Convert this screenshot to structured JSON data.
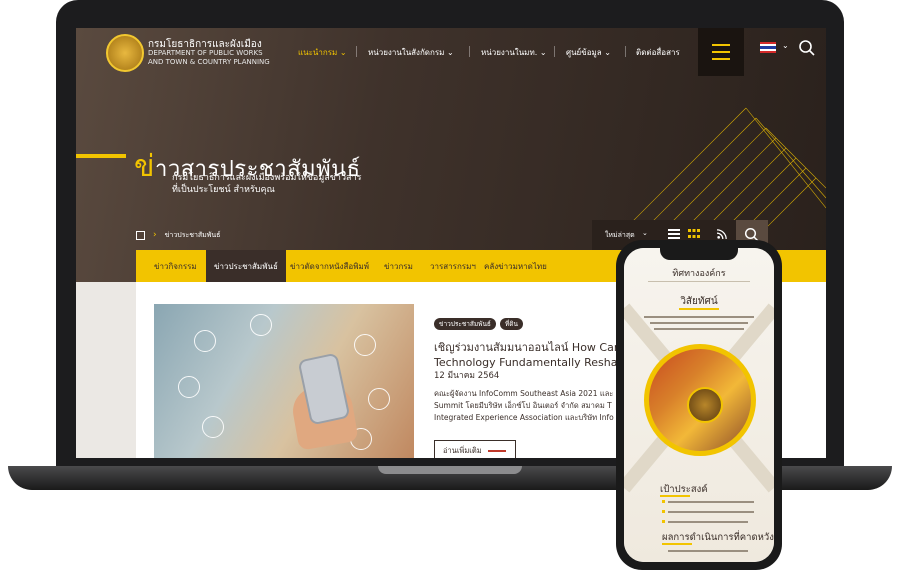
{
  "header": {
    "logo_thai": "กรมโยธาธิการและผังเมือง",
    "logo_en_line1": "DEPARTMENT OF PUBLIC WORKS",
    "logo_en_line2": "AND TOWN & COUNTRY PLANNING",
    "menu": [
      {
        "label": "แนะนำกรม",
        "active": true
      },
      {
        "label": "หน่วยงานในสังกัดกรม"
      },
      {
        "label": "หน่วยงานในมท."
      },
      {
        "label": "ศูนย์ข้อมูล"
      },
      {
        "label": "ติดต่อสื่อสาร"
      }
    ],
    "icons": [
      "menu-icon",
      "thai-flag-icon",
      "search-icon"
    ]
  },
  "hero": {
    "title_first": "ข่",
    "title_rest": "าวสารประชาสัมพันธ์",
    "subtitle_line1": "กรมโยธาธิการและผังเมืองพร้อมให้ข้อมูลข่าวสาร",
    "subtitle_line2": "ที่เป็นประโยชน์ สำหรับคุณ"
  },
  "breadcrumb": {
    "current": "ข่าวประชาสัมพันธ์"
  },
  "toolbar": {
    "sort_label": "ใหม่ล่าสุด"
  },
  "tabs": [
    {
      "label": "ข่าวกิจกรรม"
    },
    {
      "label": "ข่าวประชาสัมพันธ์",
      "active": true
    },
    {
      "label": "ข่าวตัดจากหนังสือพิมพ์"
    },
    {
      "label": "ข่าวกรม"
    },
    {
      "label": "วารสารกรมฯ"
    },
    {
      "label": "คลังข่าวมหาดไทย"
    }
  ],
  "news": {
    "tags": [
      "ข่าวประชาสัมพันธ์",
      "ที่ดิน"
    ],
    "title_line1": "เชิญร่วมงานสัมมนาออนไลน์ How Can",
    "title_line2": "Technology Fundamentally Reshap",
    "date": "12 มีนาคม 2564",
    "body_line1": "คณะผู้จัดงาน InfoComm Southeast Asia 2021 และ",
    "body_line2": "Summit โดยมีบริษัท เอ็กซ์โป อินเตอร์ จำกัด สมาคม T",
    "body_line3": "Integrated Experience Association และบริษัท Info",
    "read_more": "อ่านเพิ่มเติม"
  },
  "phone": {
    "heading": "ทิศทางองค์กร",
    "vision": "วิสัยทัศน์",
    "mission": "เป้าประสงค์",
    "result": "ผลการดำเนินการที่คาดหวัง"
  },
  "colors": {
    "accent": "#f2c400",
    "dark": "#3a2e29"
  }
}
